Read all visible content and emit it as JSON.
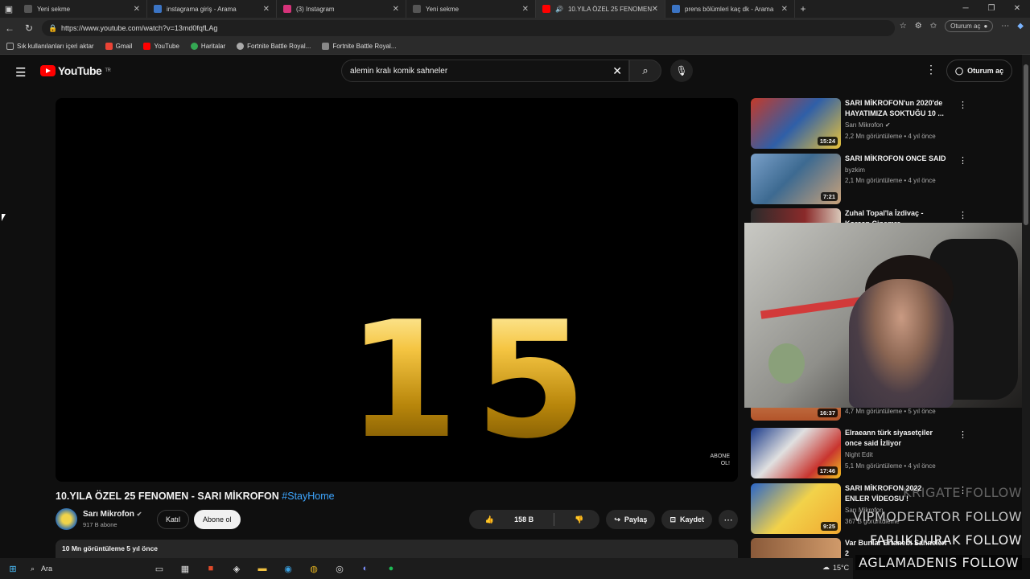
{
  "browser": {
    "tabs": [
      {
        "label": "Yeni sekme"
      },
      {
        "label": "instagrama giriş - Arama"
      },
      {
        "label": "(3) Instagram"
      },
      {
        "label": "Yeni sekme"
      },
      {
        "label": "10.YILA ÖZEL 25 FENOMEN"
      },
      {
        "label": "prens bölümleri kaç dk - Arama"
      }
    ],
    "url": "https://www.youtube.com/watch?v=13md0fqfLAg",
    "signin_label": "Oturum aç",
    "bookmarks": [
      {
        "label": "Sık kullanılanları içeri aktar"
      },
      {
        "label": "Gmail"
      },
      {
        "label": "YouTube"
      },
      {
        "label": "Haritalar"
      },
      {
        "label": "Fortnite Battle Royal..."
      },
      {
        "label": "Fortnite Battle Royal..."
      }
    ]
  },
  "youtube": {
    "logo_text": "YouTube",
    "logo_region": "TR",
    "search_query": "alemin kralı komik sahneler",
    "signin_label": "Oturum aç"
  },
  "video": {
    "overlay_number": "15",
    "watermark": "ABONE\nOL!",
    "title": "10.YILA ÖZEL 25 FENOMEN - SARI MİKROFON ",
    "hashtag": "#StayHome",
    "channel_name": "Sarı Mikrofon",
    "subscribers": "917 B abone",
    "join_label": "Katıl",
    "subscribe_label": "Abone ol",
    "likes": "158 B",
    "share_label": "Paylaş",
    "save_label": "Kaydet",
    "views_line": "10 Mn görüntüleme  5 yıl önce"
  },
  "recommendations": [
    {
      "title": "SARI MİKROFON'un 2020'de HAYATIMIZA SOKTUĞU 10 ...",
      "channel": "Sarı Mikrofon",
      "meta": "2,2 Mn görüntüleme • 4 yıl önce",
      "duration": "15:24"
    },
    {
      "title": "SARI MİKROFON ONCE SAID",
      "channel": "byzkim",
      "meta": "2,1 Mn görüntüleme • 4 yıl önce",
      "duration": "7:21"
    },
    {
      "title": "Zuhal Topal'la İzdivaç - Korcan Cinemre",
      "channel": "",
      "meta": "",
      "duration": ""
    },
    {
      "title": "",
      "channel": "",
      "meta": "4,7 Mn görüntüleme • 5 yıl önce",
      "duration": "16:37"
    },
    {
      "title": "Elraeann türk siyasetçiler once said İzliyor",
      "channel": "Night Edit",
      "meta": "5,1 Mn görüntüleme • 4 yıl önce",
      "duration": "17:46"
    },
    {
      "title": "SARI MİKROFON 2022 ENLER VİDEOSU !",
      "channel": "Sarı Mikrofon",
      "meta": "367 B görüntüleme",
      "duration": "9:25"
    },
    {
      "title": "Var Bunlar Ertanebi Sahneleri 2",
      "channel": "",
      "meta": "",
      "duration": ""
    }
  ],
  "stream_overlay": {
    "follows": [
      "KRIGATE  FOLLOW",
      "VIPMODERATOR  FOLLOW",
      "FARUKDURAK  FOLLOW",
      "AGLAMADENIS  FOLLOW"
    ]
  },
  "taskbar": {
    "search_label": "Ara",
    "temperature": "15°C"
  },
  "colors": {
    "youtube_red": "#ff0000",
    "hashtag_blue": "#3ea6ff",
    "background": "#0f0f0f"
  }
}
